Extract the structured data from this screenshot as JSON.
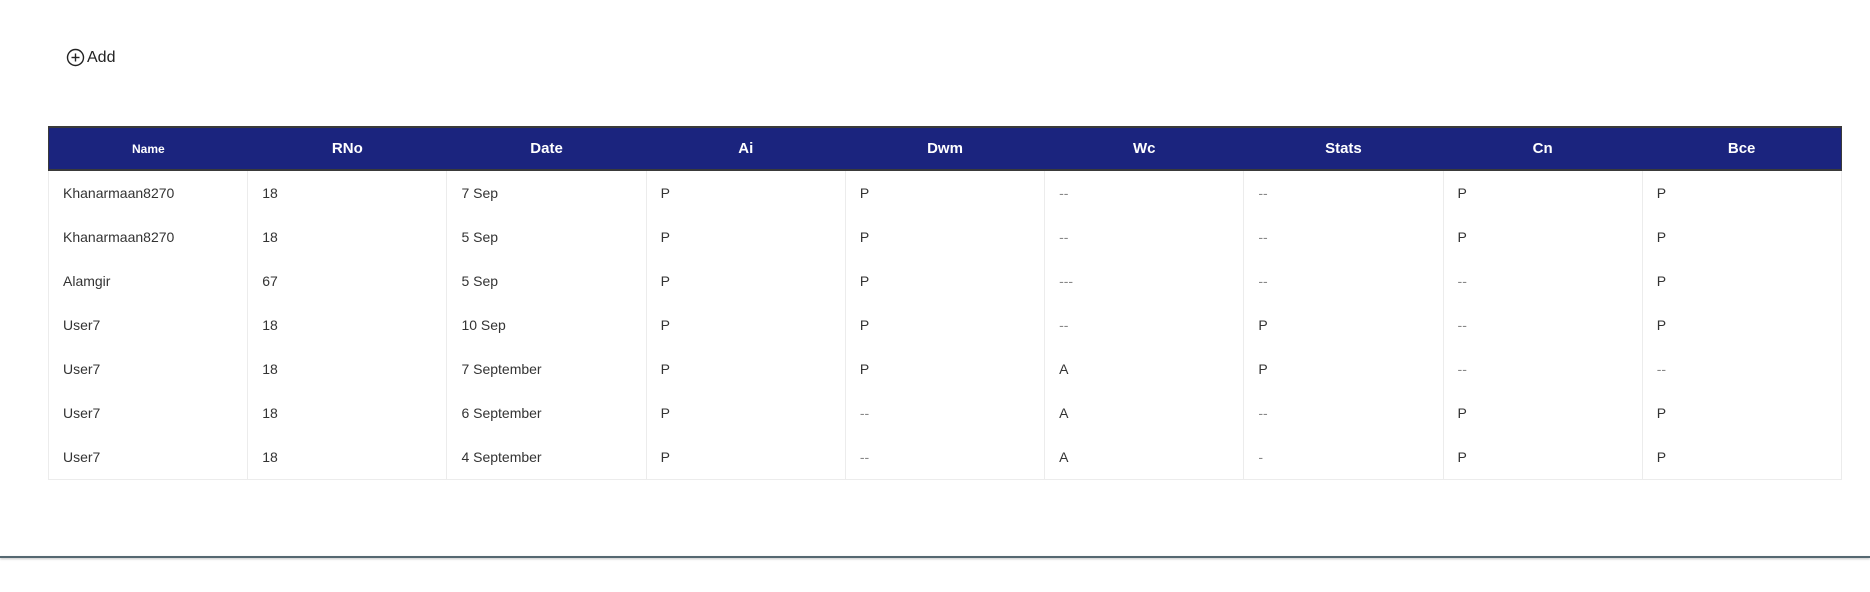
{
  "toolbar": {
    "add_label": "Add",
    "add_icon": "plus-circle-icon"
  },
  "table": {
    "columns": [
      "Name",
      "RNo",
      "Date",
      "Ai",
      "Dwm",
      "Wc",
      "Stats",
      "Cn",
      "Bce"
    ],
    "rows": [
      [
        "Khanarmaan8270",
        "18",
        "7 Sep",
        "P",
        "P",
        "--",
        "--",
        "P",
        "P"
      ],
      [
        "Khanarmaan8270",
        "18",
        "5 Sep",
        "P",
        "P",
        "--",
        "--",
        "P",
        "P"
      ],
      [
        "Alamgir",
        "67",
        "5 Sep",
        "P",
        "P",
        "---",
        "--",
        "--",
        "P"
      ],
      [
        "User7",
        "18",
        "10 Sep",
        "P",
        "P",
        "--",
        "P",
        "--",
        "P"
      ],
      [
        "User7",
        "18",
        "7 September",
        "P",
        "P",
        "A",
        "P",
        "--",
        "--"
      ],
      [
        "User7",
        "18",
        "6 September",
        "P",
        "--",
        "A",
        "--",
        "P",
        "P"
      ],
      [
        "User7",
        "18",
        "4 September",
        "P",
        "--",
        "A",
        "-",
        "P",
        "P"
      ]
    ]
  },
  "colors": {
    "header_bg": "#1b247e",
    "header_text": "#ffffff",
    "bottom_rule": "#556871"
  }
}
